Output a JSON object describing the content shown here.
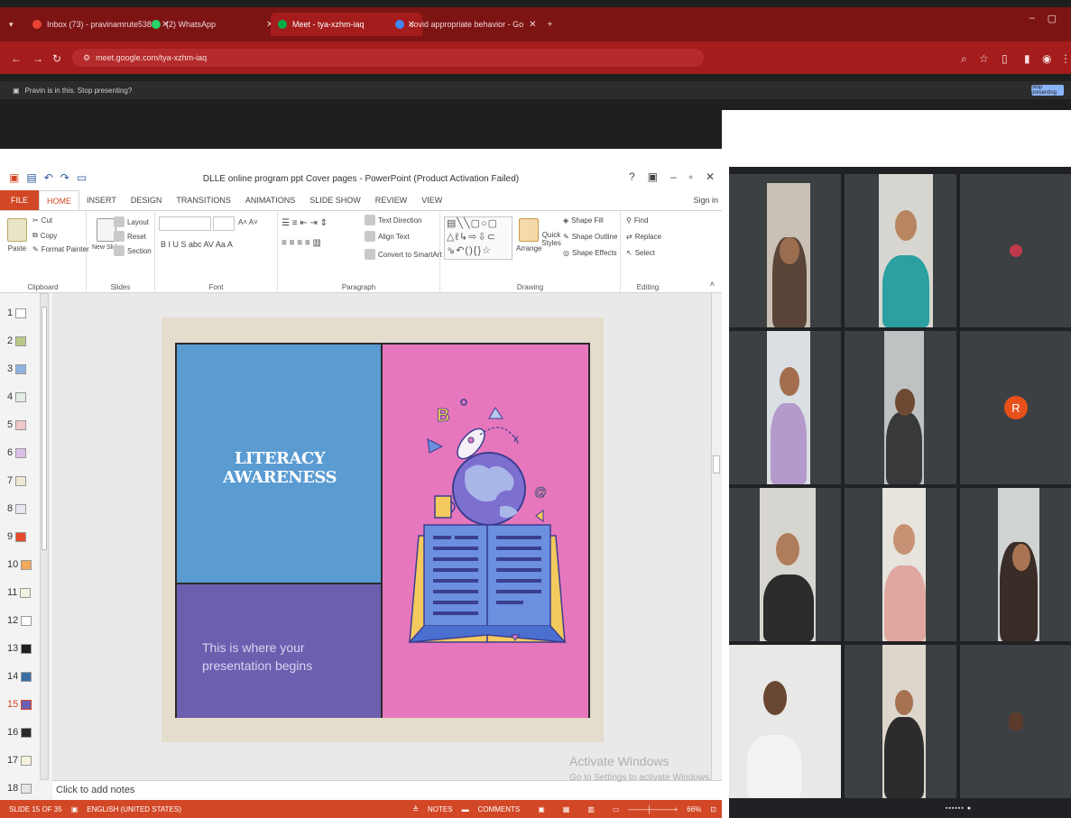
{
  "browser": {
    "tabs": [
      {
        "label": "Inbox (73) - pravinamrute5388",
        "color": "#ea4335"
      },
      {
        "label": "(2) WhatsApp",
        "color": "#25d366"
      },
      {
        "label": "Meet - tya-xzhm-iaq",
        "color": "#00ac47"
      },
      {
        "label": "covid appropriate behavior - Go",
        "color": "#4285f4"
      }
    ],
    "url": "meet.google.com/tya-xzhm-iaq",
    "info": "Pravin is in this. Stop presenting?",
    "share_label": "Stop presenting"
  },
  "ppt": {
    "title": "DLLE online program ppt Cover pages - PowerPoint (Product Activation Failed)",
    "win_help": "?",
    "menus": [
      "FILE",
      "HOME",
      "INSERT",
      "DESIGN",
      "TRANSITIONS",
      "ANIMATIONS",
      "SLIDE SHOW",
      "REVIEW",
      "VIEW"
    ],
    "sign_in": "Sign in",
    "ribbon": {
      "paste": "Paste",
      "cut": "Cut",
      "copy": "Copy",
      "format_painter": "Format Painter",
      "new_slide": "New Slide",
      "layout": "Layout",
      "reset": "Reset",
      "section": "Section",
      "text_direction": "Text Direction",
      "align_text": "Align Text",
      "convert_smartart": "Convert to SmartArt",
      "arrange": "Arrange",
      "quick_styles": "Quick Styles",
      "shape_fill": "Shape Fill",
      "shape_outline": "Shape Outline",
      "shape_effects": "Shape Effects",
      "find": "Find",
      "replace": "Replace",
      "select": "Select",
      "font_format": "B I U S abc AV Aa A",
      "groups": {
        "clipboard": "Clipboard",
        "slides": "Slides",
        "font": "Font",
        "paragraph": "Paragraph",
        "drawing": "Drawing",
        "editing": "Editing"
      }
    },
    "thumbs": [
      "1",
      "2",
      "3",
      "4",
      "5",
      "6",
      "7",
      "8",
      "9",
      "10",
      "11",
      "12",
      "13",
      "14",
      "15",
      "16",
      "17",
      "18"
    ],
    "selected_slide": "15",
    "slide": {
      "title": "LITERACY AWARENESS",
      "subtitle": "This is where your presentation begins"
    },
    "notes": "Click to add notes",
    "activate1": "Activate Windows",
    "activate2": "Go to Settings to activate Windows.",
    "status": {
      "slide": "SLIDE 15 OF 35",
      "language": "ENGLISH (UNITED STATES)",
      "notes": "NOTES",
      "comments": "COMMENTS",
      "zoom": "66%"
    }
  },
  "meet": {
    "avatar_letter": "R",
    "avatar_color": "#e8501a"
  }
}
